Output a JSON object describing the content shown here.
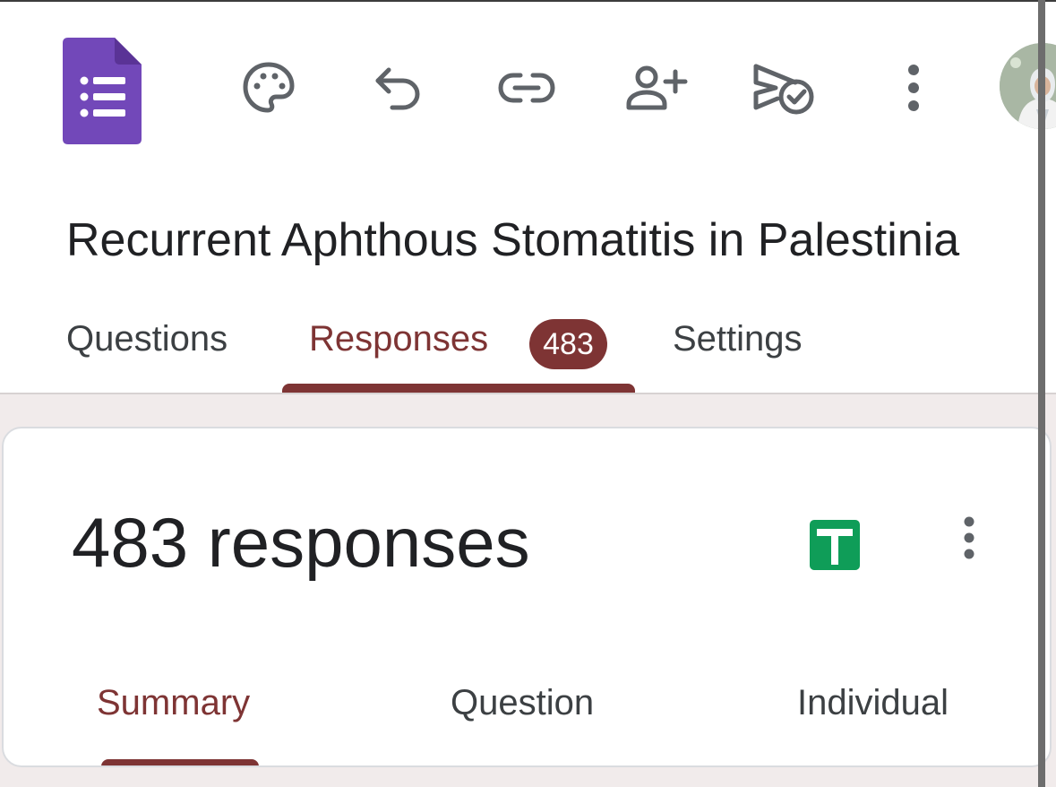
{
  "toolbar": {
    "app_icon": "google-forms-icon",
    "actions": [
      {
        "name": "palette-icon",
        "label": "Customize theme"
      },
      {
        "name": "undo-icon",
        "label": "Undo"
      },
      {
        "name": "link-icon",
        "label": "Copy link"
      },
      {
        "name": "add-collaborator-icon",
        "label": "Add collaborators"
      },
      {
        "name": "publish-icon",
        "label": "Publish"
      },
      {
        "name": "more-vert-icon",
        "label": "More options"
      }
    ],
    "avatar": "user-avatar"
  },
  "form": {
    "title": "Recurrent Aphthous Stomatitis in Palestinia"
  },
  "tabs": {
    "questions": "Questions",
    "responses": "Responses",
    "responses_count": "483",
    "settings": "Settings",
    "active": "responses"
  },
  "responses_card": {
    "title": "483 responses",
    "sheets_icon": "google-sheets-icon",
    "more_icon": "more-vert-icon",
    "subtabs": {
      "summary": "Summary",
      "question": "Question",
      "individual": "Individual",
      "active": "summary"
    }
  },
  "colors": {
    "accent": "#7e3434",
    "forms_purple": "#673ab7",
    "sheets_green": "#0f9d58",
    "icon_gray": "#5f6368",
    "body_background": "#f1ebeb"
  }
}
